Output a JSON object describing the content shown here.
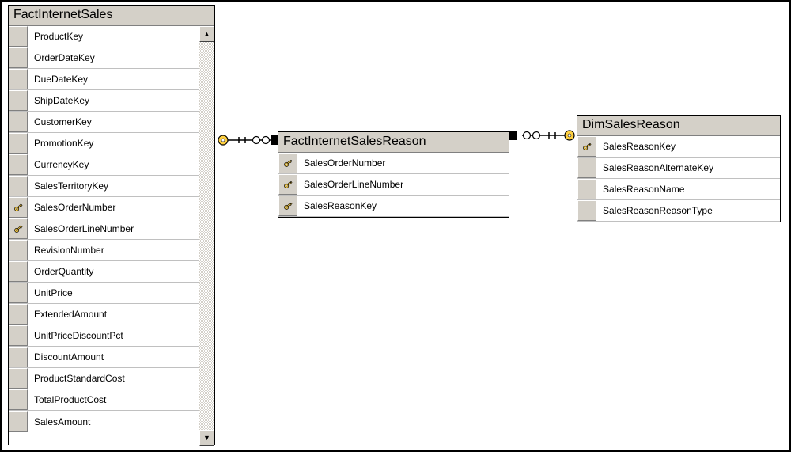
{
  "tables": {
    "factInternetSales": {
      "title": "FactInternetSales",
      "columns": [
        {
          "name": "ProductKey",
          "key": false
        },
        {
          "name": "OrderDateKey",
          "key": false
        },
        {
          "name": "DueDateKey",
          "key": false
        },
        {
          "name": "ShipDateKey",
          "key": false
        },
        {
          "name": "CustomerKey",
          "key": false
        },
        {
          "name": "PromotionKey",
          "key": false
        },
        {
          "name": "CurrencyKey",
          "key": false
        },
        {
          "name": "SalesTerritoryKey",
          "key": false
        },
        {
          "name": "SalesOrderNumber",
          "key": true
        },
        {
          "name": "SalesOrderLineNumber",
          "key": true
        },
        {
          "name": "RevisionNumber",
          "key": false
        },
        {
          "name": "OrderQuantity",
          "key": false
        },
        {
          "name": "UnitPrice",
          "key": false
        },
        {
          "name": "ExtendedAmount",
          "key": false
        },
        {
          "name": "UnitPriceDiscountPct",
          "key": false
        },
        {
          "name": "DiscountAmount",
          "key": false
        },
        {
          "name": "ProductStandardCost",
          "key": false
        },
        {
          "name": "TotalProductCost",
          "key": false
        },
        {
          "name": "SalesAmount",
          "key": false
        }
      ]
    },
    "factInternetSalesReason": {
      "title": "FactInternetSalesReason",
      "columns": [
        {
          "name": "SalesOrderNumber",
          "key": true
        },
        {
          "name": "SalesOrderLineNumber",
          "key": true
        },
        {
          "name": "SalesReasonKey",
          "key": true
        }
      ]
    },
    "dimSalesReason": {
      "title": "DimSalesReason",
      "columns": [
        {
          "name": "SalesReasonKey",
          "key": true
        },
        {
          "name": "SalesReasonAlternateKey",
          "key": false
        },
        {
          "name": "SalesReasonName",
          "key": false
        },
        {
          "name": "SalesReasonReasonType",
          "key": false
        }
      ]
    }
  },
  "relationships": [
    {
      "from": "factInternetSales",
      "to": "factInternetSalesReason",
      "fromEnd": "one",
      "toEnd": "many"
    },
    {
      "from": "factInternetSalesReason",
      "to": "dimSalesReason",
      "fromEnd": "many",
      "toEnd": "one"
    }
  ],
  "scroll": {
    "up": "▲",
    "down": "▼"
  }
}
